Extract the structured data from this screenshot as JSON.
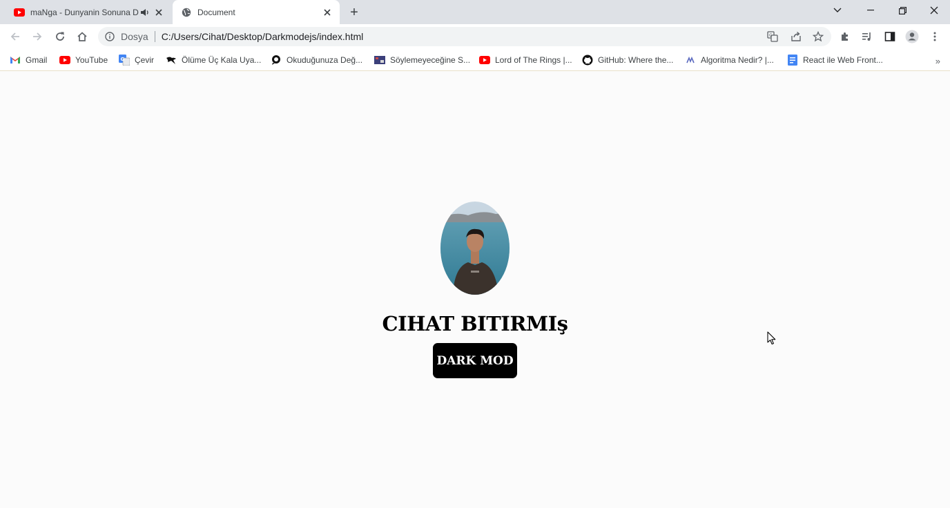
{
  "browser": {
    "tabs": [
      {
        "title": "maNga - Dunyanin Sonuna D",
        "favicon": "youtube-icon",
        "audio": "speaker-icon",
        "active": false
      },
      {
        "title": "Document",
        "favicon": "globe-icon",
        "active": true
      }
    ],
    "new_tab_label": "+",
    "window_controls": [
      "tab-search-icon",
      "minimize-icon",
      "restore-icon",
      "close-icon"
    ]
  },
  "toolbar": {
    "address": {
      "scheme_label": "Dosya",
      "url": "C:/Users/Cihat/Desktop/Darkmodejs/index.html"
    }
  },
  "bookmarks": [
    {
      "label": "Gmail",
      "icon": "gmail-icon"
    },
    {
      "label": "YouTube",
      "icon": "youtube-icon"
    },
    {
      "label": "Çevir",
      "icon": "translate-icon"
    },
    {
      "label": "Ölüme Üç Kala Uya...",
      "icon": "bird-icon"
    },
    {
      "label": "Okuduğunuza Değ...",
      "icon": "speech-bubble-icon"
    },
    {
      "label": "Söylemeyeceğine S...",
      "icon": "image-icon"
    },
    {
      "label": "Lord of The Rings |...",
      "icon": "youtube-icon"
    },
    {
      "label": "GitHub: Where the...",
      "icon": "github-icon"
    },
    {
      "label": "Algoritma Nedir? |...",
      "icon": "site-icon"
    },
    {
      "label": "React ile Web Front...",
      "icon": "document-icon"
    }
  ],
  "page": {
    "heading": "CIHAT BITIRMIş",
    "button_label": "DARK MOD"
  },
  "colors": {
    "page_bg": "#fbfbfb",
    "button_bg": "#000000",
    "button_text": "#ffffff",
    "heading": "#000000"
  }
}
